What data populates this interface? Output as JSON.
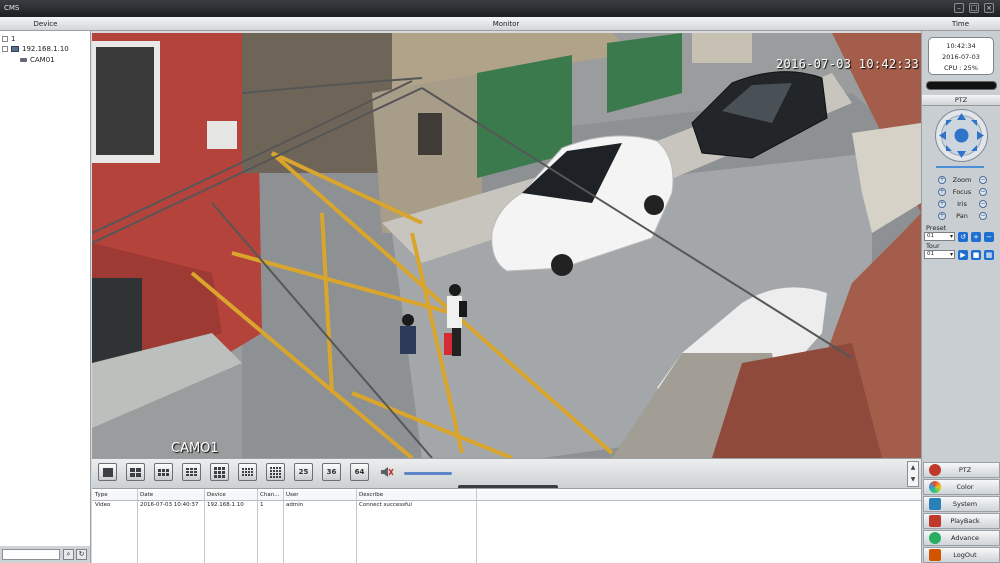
{
  "window": {
    "title": "CMS"
  },
  "headers": {
    "device": "Device",
    "monitor": "Monitor",
    "time": "Time"
  },
  "device_tree": [
    {
      "label": "1"
    },
    {
      "label": "192.168.1.10"
    },
    {
      "label": "CAM01"
    }
  ],
  "video": {
    "osd_timestamp": "2016-07-03  10:42:33",
    "osd_camera": "CAMO1"
  },
  "toolbar": {
    "buttons": [
      "1",
      "4",
      "6",
      "8",
      "9",
      "13",
      "16",
      "25",
      "36",
      "64"
    ],
    "labels": {
      "b25": "25",
      "b36": "36",
      "b64": "64"
    }
  },
  "log": {
    "columns": [
      "Type",
      "Date",
      "Device",
      "Chan...",
      "User",
      "Describe"
    ],
    "rows": [
      {
        "type": "Video",
        "date": "2016-07-03 10:40:37",
        "device": "192.168.1.10",
        "channel": "1",
        "user": "admin",
        "describe": "Connect successful"
      }
    ]
  },
  "status": {
    "time": "10:42:34",
    "date": "2016-07-03",
    "cpu": "CPU : 25%"
  },
  "ptz": {
    "title": "PTZ",
    "controls": [
      "Zoom",
      "Focus",
      "Iris",
      "Pan"
    ],
    "preset_label": "Preset",
    "preset_value": "01",
    "tour_label": "Tour",
    "tour_value": "01"
  },
  "menu": [
    {
      "label": "PTZ",
      "icon": "ptz-icon",
      "color": "#c0392b"
    },
    {
      "label": "Color",
      "icon": "color-icon",
      "color": "#27ae60"
    },
    {
      "label": "System",
      "icon": "system-icon",
      "color": "#2980b9"
    },
    {
      "label": "PlayBack",
      "icon": "playback-icon",
      "color": "#c0392b"
    },
    {
      "label": "Advance",
      "icon": "advance-icon",
      "color": "#27ae60"
    },
    {
      "label": "LogOut",
      "icon": "logout-icon",
      "color": "#d35400"
    }
  ]
}
